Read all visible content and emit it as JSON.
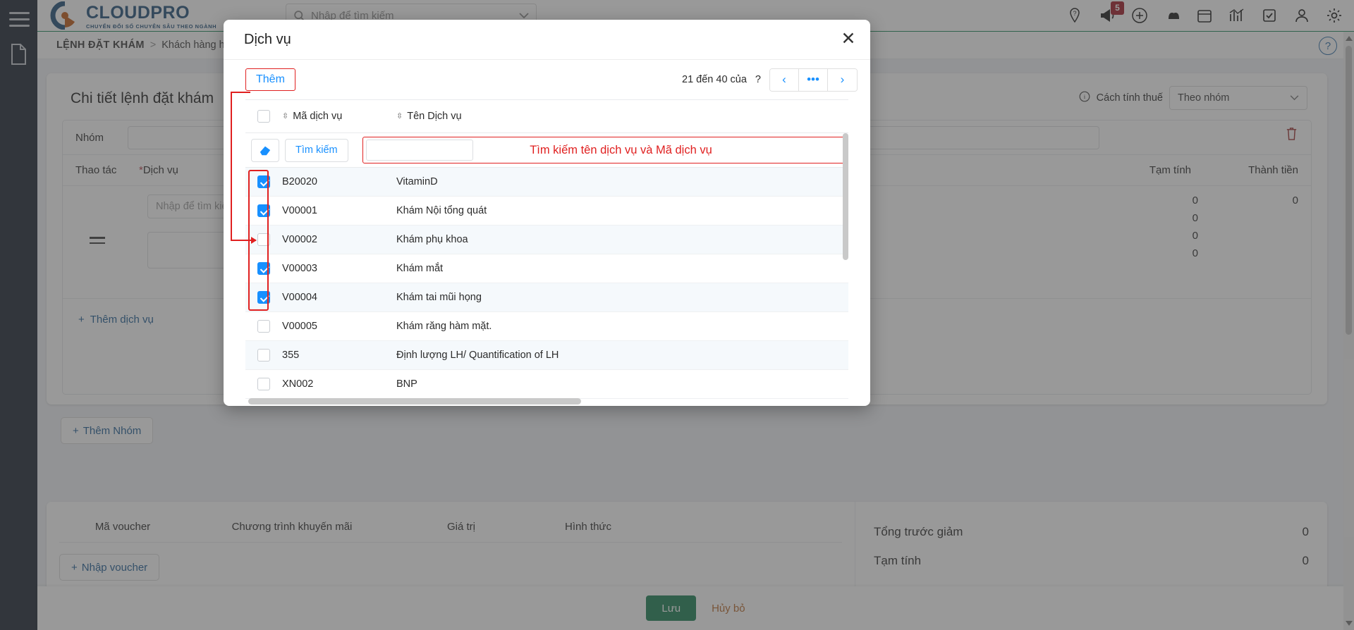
{
  "brand": {
    "name": "CLOUDPRO",
    "tagline": "CHUYỂN ĐỔI SỐ CHUYÊN SÂU THEO NGÀNH",
    "primary_color": "#1f4e79",
    "accent_color": "#c05a14"
  },
  "topbar": {
    "search_placeholder": "Nhập để tìm kiếm",
    "notification_badge": "5",
    "icons": [
      "help-pin-icon",
      "megaphone-icon",
      "plus-circle-icon",
      "bells-icon",
      "calendar-icon",
      "chart-icon",
      "task-check-icon",
      "user-icon",
      "gear-icon"
    ]
  },
  "breadcrumb": {
    "root": "LỆNH ĐẶT KHÁM",
    "separator": ">",
    "current": "Khách hàng hẹn thái",
    "help_label": "?"
  },
  "main_card": {
    "title": "Chi tiết lệnh đặt khám",
    "tax": {
      "label": "Cách tính thuế",
      "value": "Theo nhóm",
      "info_icon": "info-icon",
      "chevron": "chevron-down-icon"
    },
    "group_label": "Nhóm",
    "columns": {
      "action": "Thao tác",
      "service": "Dịch vụ",
      "service_required_mark": "*",
      "subtotal": "Tạm tính",
      "total": "Thành tiền"
    },
    "service_input_placeholder": "Nhập để tìm kiếm",
    "row_values": {
      "subtotal": [
        "0",
        "0",
        "0",
        "0"
      ],
      "total": "0"
    },
    "add_service_label": "Thêm dịch vụ",
    "add_group_label": "Thêm Nhóm",
    "delete_icon": "trash-icon",
    "drag_icon": "drag-handle-icon",
    "plus_icon": "plus-icon"
  },
  "voucher_card": {
    "columns": [
      "Mã voucher",
      "Chương trình khuyến mãi",
      "Giá trị",
      "Hình thức"
    ],
    "add_voucher_label": "Nhập voucher",
    "summary": [
      {
        "label": "Tổng trước giảm",
        "value": "0"
      },
      {
        "label": "Tạm tính",
        "value": "0"
      }
    ]
  },
  "bottom_bar": {
    "save_label": "Lưu",
    "cancel_label": "Hủy bỏ",
    "save_color": "#1a7f53",
    "cancel_color": "#b9692a"
  },
  "modal": {
    "title": "Dịch vụ",
    "close_icon": "close-icon",
    "add_label": "Thêm",
    "pager_text": "21 đến 40 của",
    "pager_unknown": "?",
    "pager_prev": "‹",
    "pager_more": "•••",
    "pager_next": "›",
    "columns": {
      "code": "Mã dịch vụ",
      "name": "Tên Dịch vụ"
    },
    "filter": {
      "eraser_icon": "eraser-icon",
      "search_label": "Tìm kiếm",
      "code_value": "",
      "name_value": ""
    },
    "annotation": "Tìm kiếm tên dịch vụ và Mã dịch vụ",
    "annotation_color": "#e02020",
    "rows": [
      {
        "checked": true,
        "code": "B20020",
        "name": "VitaminD"
      },
      {
        "checked": true,
        "code": "V00001",
        "name": "Khám Nội tổng quát"
      },
      {
        "checked": false,
        "code": "V00002",
        "name": "Khám phụ khoa"
      },
      {
        "checked": true,
        "code": "V00003",
        "name": "Khám mắt"
      },
      {
        "checked": true,
        "code": "V00004",
        "name": "Khám tai mũi họng"
      },
      {
        "checked": false,
        "code": "V00005",
        "name": "Khám răng hàm mặt."
      },
      {
        "checked": false,
        "code": "355",
        "name": "Định lượng LH/ Quantification of LH"
      },
      {
        "checked": false,
        "code": "XN002",
        "name": "BNP"
      }
    ]
  }
}
